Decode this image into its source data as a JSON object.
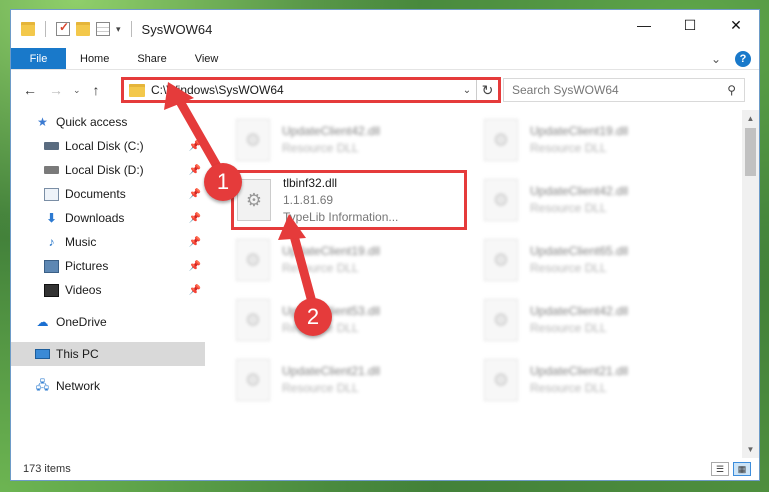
{
  "window": {
    "title": "SysWOW64",
    "controls": {
      "minimize": "—",
      "maximize": "☐",
      "close": "✕"
    }
  },
  "ribbon": {
    "tabs": [
      "File",
      "Home",
      "Share",
      "View"
    ],
    "expand_icon": "chevron-down-icon",
    "help_label": "?"
  },
  "nav": {
    "back": "←",
    "forward": "→",
    "recent": "⌄",
    "up": "↑",
    "address": "C:\\Windows\\SysWOW64",
    "address_dropdown": "⌄",
    "refresh": "↻",
    "search_placeholder": "Search SysWOW64",
    "search_icon": "⚲"
  },
  "sidebar": {
    "items": [
      {
        "label": "Quick access",
        "icon": "star-icon"
      },
      {
        "label": "Local Disk (C:)",
        "icon": "drive-icon",
        "pinned": true
      },
      {
        "label": "Local Disk (D:)",
        "icon": "drive-icon",
        "pinned": true
      },
      {
        "label": "Documents",
        "icon": "documents-icon",
        "pinned": true
      },
      {
        "label": "Downloads",
        "icon": "downloads-icon",
        "pinned": true
      },
      {
        "label": "Music",
        "icon": "music-icon",
        "pinned": true
      },
      {
        "label": "Pictures",
        "icon": "pictures-icon",
        "pinned": true
      },
      {
        "label": "Videos",
        "icon": "videos-icon",
        "pinned": true
      },
      {
        "label": "OneDrive",
        "icon": "cloud-icon"
      },
      {
        "label": "This PC",
        "icon": "computer-icon",
        "selected": true
      },
      {
        "label": "Network",
        "icon": "network-icon"
      }
    ],
    "pin_glyph": "📌"
  },
  "files": [
    {
      "name": "UpdateClient42.dll",
      "type": "Resource DLL"
    },
    {
      "name": "UpdateClient19.dll",
      "type": "Resource DLL"
    },
    {
      "name": "tlbinf32.dll",
      "version": "1.1.81.69",
      "type": "TypeLib Information..."
    },
    {
      "name": "UpdateClient42.dll",
      "type": "Resource DLL"
    },
    {
      "name": "UpdateClient19.dll",
      "type": "Resource DLL"
    },
    {
      "name": "UpdateClient65.dll",
      "type": "Resource DLL"
    },
    {
      "name": "UpdateClient53.dll",
      "type": "Resource DLL"
    },
    {
      "name": "UpdateClient42.dll",
      "type": "Resource DLL"
    },
    {
      "name": "UpdateClient21.dll",
      "type": "Resource DLL"
    },
    {
      "name": "UpdateClient21.dll",
      "type": "Resource DLL"
    }
  ],
  "status": {
    "item_count": "173 items"
  },
  "annotations": {
    "step1": "1",
    "step2": "2",
    "color": "#e53b3b"
  }
}
